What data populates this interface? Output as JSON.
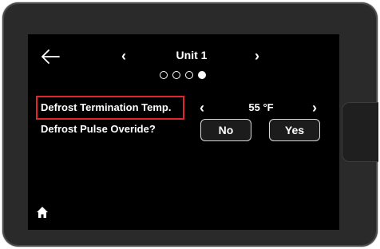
{
  "header": {
    "title": "Unit 1",
    "page_count": 4,
    "current_page": 4
  },
  "settings": {
    "defrost_temp": {
      "label": "Defrost Termination Temp.",
      "value": "55 °F"
    },
    "defrost_pulse": {
      "label": "Defrost Pulse Overide?",
      "options": [
        "No",
        "Yes"
      ],
      "selected": "No"
    }
  },
  "icons": {
    "back": "back-arrow-icon",
    "prev": "chevron-left-icon",
    "next": "chevron-right-icon",
    "home": "home-icon"
  },
  "colors": {
    "screen": "#000000",
    "text": "#ffffff",
    "highlight": "#e0262c"
  }
}
